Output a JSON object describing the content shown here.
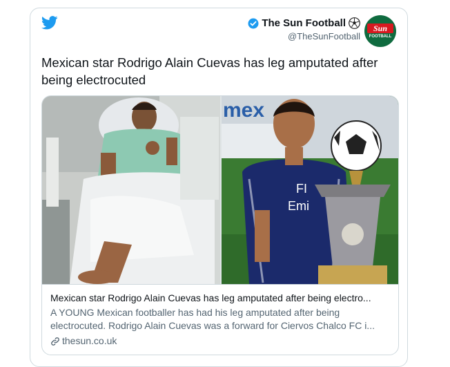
{
  "tweet": {
    "author": {
      "name": "The Sun Football",
      "handle": "@TheSunFootball",
      "avatar_text": "Sun",
      "avatar_subtext": "FOOTBALL",
      "verified": true
    },
    "text": "Mexican star Rodrigo Alain Cuevas has leg amputated after being electrocuted",
    "card": {
      "title": "Mexican star Rodrigo Alain Cuevas has leg amputated after being electro...",
      "description": "A YOUNG Mexican footballer has had his leg amputated after being electrocuted. Rodrigo Alain Cuevas was a forward for Ciervos Chalco FC i...",
      "domain": "thesun.co.uk",
      "image_left": {
        "caption": ""
      },
      "image_right": {
        "sign_text": "mex",
        "shirt_text_1": "FI",
        "shirt_text_2": "Emi"
      }
    }
  },
  "icons": {
    "platform": "twitter-bird-icon",
    "verified": "verified-badge-icon",
    "emoji": "soccer-ball-emoji",
    "link": "link-icon"
  },
  "colors": {
    "twitter_blue": "#1d9bf0",
    "text_primary": "#0f1419",
    "text_secondary": "#536471",
    "border": "#cfd9de",
    "sun_red": "#d71920",
    "sun_green": "#0f6b3f"
  }
}
